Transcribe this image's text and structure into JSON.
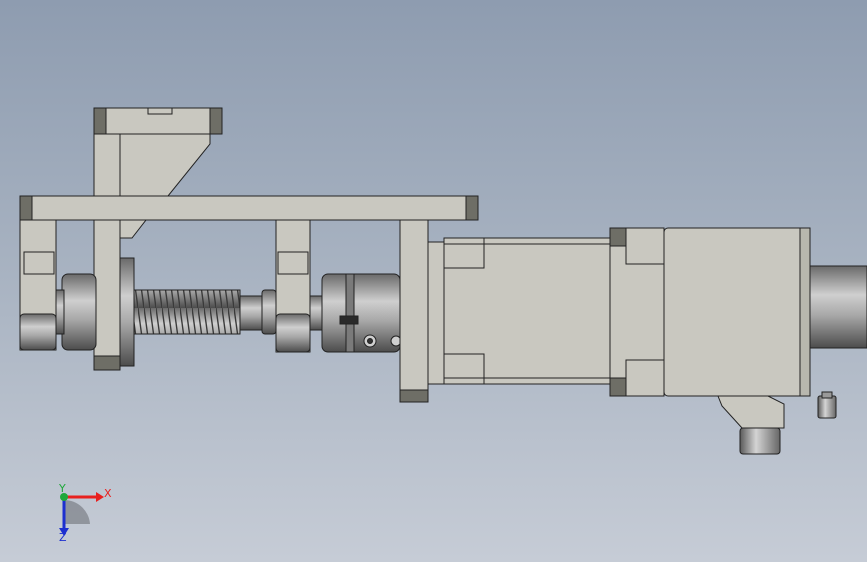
{
  "viewport": {
    "background_top": "#8e9cb0",
    "background_bottom": "#c6ccd6"
  },
  "triad": {
    "x_label": "X",
    "y_label": "Y",
    "z_label": "Z",
    "x_color": "#e8201e",
    "y_color": "#1fa83a",
    "z_color": "#1d2fd0"
  },
  "part_colors": {
    "face": "#c9c8c0",
    "edge": "#222222",
    "dark_face": "#6e6e66",
    "shaft": "#8f8f8f"
  }
}
